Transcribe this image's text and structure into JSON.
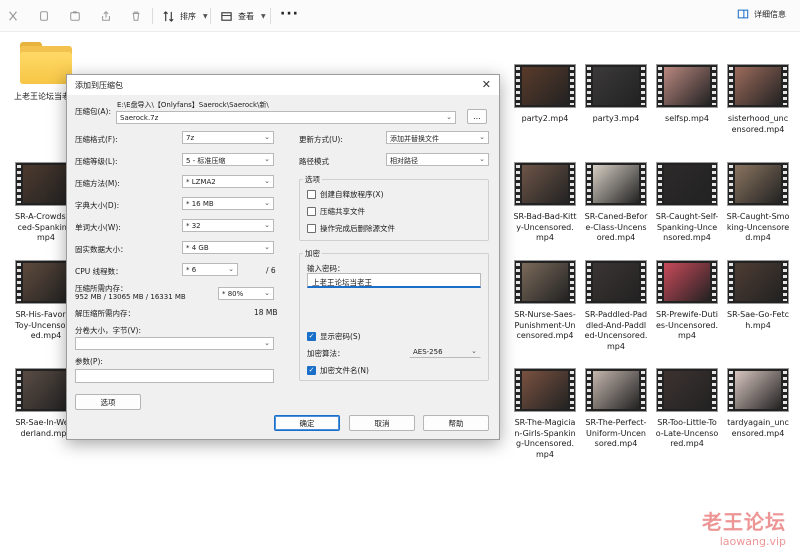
{
  "toolbar": {
    "sort_label": "排序",
    "view_label": "查看",
    "details_label": "详细信息"
  },
  "files": [
    {
      "name": "上老王论坛当老王",
      "type": "folder"
    },
    {
      "name": "party2.mp4",
      "type": "video",
      "color": "#5a3b2a"
    },
    {
      "name": "party3.mp4",
      "type": "video",
      "color": "#3c3a3a"
    },
    {
      "name": "selfsp.mp4",
      "type": "video",
      "color": "#b9877f"
    },
    {
      "name": "sisterhood_uncensored.mp4",
      "type": "video",
      "color": "#9c6b5c"
    },
    {
      "name": "SR-A-Crowds…rced-Spanking.mp4",
      "type": "video",
      "color": "#4d3a2e"
    },
    {
      "name": "SR-Bad-Bad-Kitty-Uncensored.mp4",
      "type": "video",
      "color": "#6e5548"
    },
    {
      "name": "SR-Caned-Before-Class-Uncensored.mp4",
      "type": "video",
      "color": "#d7cfc4"
    },
    {
      "name": "SR-Caught-Self-Spanking-Uncensored.mp4",
      "type": "video",
      "color": "#2d2a2a"
    },
    {
      "name": "SR-Caught-Smoking-Uncensored.mp4",
      "type": "video",
      "color": "#8a7460"
    },
    {
      "name": "SR-His-Favor…-Toy-Uncensor…ed.mp4",
      "type": "video",
      "color": "#5e4a3c"
    },
    {
      "name": "SR-Nurse-Saes-Punishment-Uncensored.mp4",
      "type": "video",
      "color": "#7a6a5a"
    },
    {
      "name": "SR-Paddled-Paddled-And-Paddled-Uncensored.mp4",
      "type": "video",
      "color": "#3b3533"
    },
    {
      "name": "SR-Prewife-Duties-Uncensored.mp4",
      "type": "video",
      "color": "#c94a5a"
    },
    {
      "name": "SR-Sae-Go-Fetch.mp4",
      "type": "video",
      "color": "#4e3d33"
    },
    {
      "name": "SR-Sae-In-We…derland.mp4",
      "type": "video",
      "color": "#5a4c44"
    },
    {
      "name": "SR-The-Magician-Girls-Spanking-Uncensored.mp4",
      "type": "video",
      "color": "#7a5240"
    },
    {
      "name": "SR-The-Perfect-Uniform-Uncensored.mp4",
      "type": "video",
      "color": "#c4b6ad"
    },
    {
      "name": "SR-Too-Little-Too-Late-Uncensored.mp4",
      "type": "video",
      "color": "#3d3330"
    },
    {
      "name": "tardyagain_uncensored.mp4",
      "type": "video",
      "color": "#d8c6c0"
    }
  ],
  "dialog": {
    "title": "添加到压缩包",
    "archive_label": "压缩包(A):",
    "archive_path": "E:\\E盘导入\\【Onlyfans】Saerock\\Saerock\\新\\",
    "archive_name": "Saerock.7z",
    "browse_label": "...",
    "format_label": "压缩格式(F):",
    "format_value": "7z",
    "level_label": "压缩等级(L):",
    "level_value": "5 - 标准压缩",
    "method_label": "压缩方法(M):",
    "method_value": "* LZMA2",
    "dict_label": "字典大小(D):",
    "dict_value": "* 16 MB",
    "word_label": "单词大小(W):",
    "word_value": "* 32",
    "solid_label": "固实数据大小：",
    "solid_value": "* 4 GB",
    "threads_label": "CPU 线程数：",
    "threads_value": "* 6",
    "threads_total": "/ 6",
    "mem_comp_label": "压缩所需内存：",
    "mem_comp_detail": "952 MB / 13065 MB / 16331 MB",
    "mem_percent": "* 80%",
    "mem_decomp_label": "解压缩所需内存：",
    "mem_decomp_value": "18 MB",
    "split_label": "分卷大小，字节(V):",
    "params_label": "参数(P):",
    "options_button": "选项",
    "update_label": "更新方式(U):",
    "update_value": "添加并替换文件",
    "path_label": "路径模式",
    "path_value": "相对路径",
    "options_group": "选项",
    "opt_sfx": "创建自释放程序(X)",
    "opt_shared": "压缩共享文件",
    "opt_delete": "操作完成后删除源文件",
    "encrypt_group": "加密",
    "password_label": "输入密码：",
    "password_value": "上老王论坛当老王",
    "show_password": "显示密码(S)",
    "enc_method_label": "加密算法：",
    "enc_method_value": "AES-256",
    "encrypt_names": "加密文件名(N)",
    "ok": "确定",
    "cancel": "取消",
    "help": "帮助"
  },
  "watermark": {
    "brand": "老王论坛",
    "site": "laowang.vip"
  }
}
